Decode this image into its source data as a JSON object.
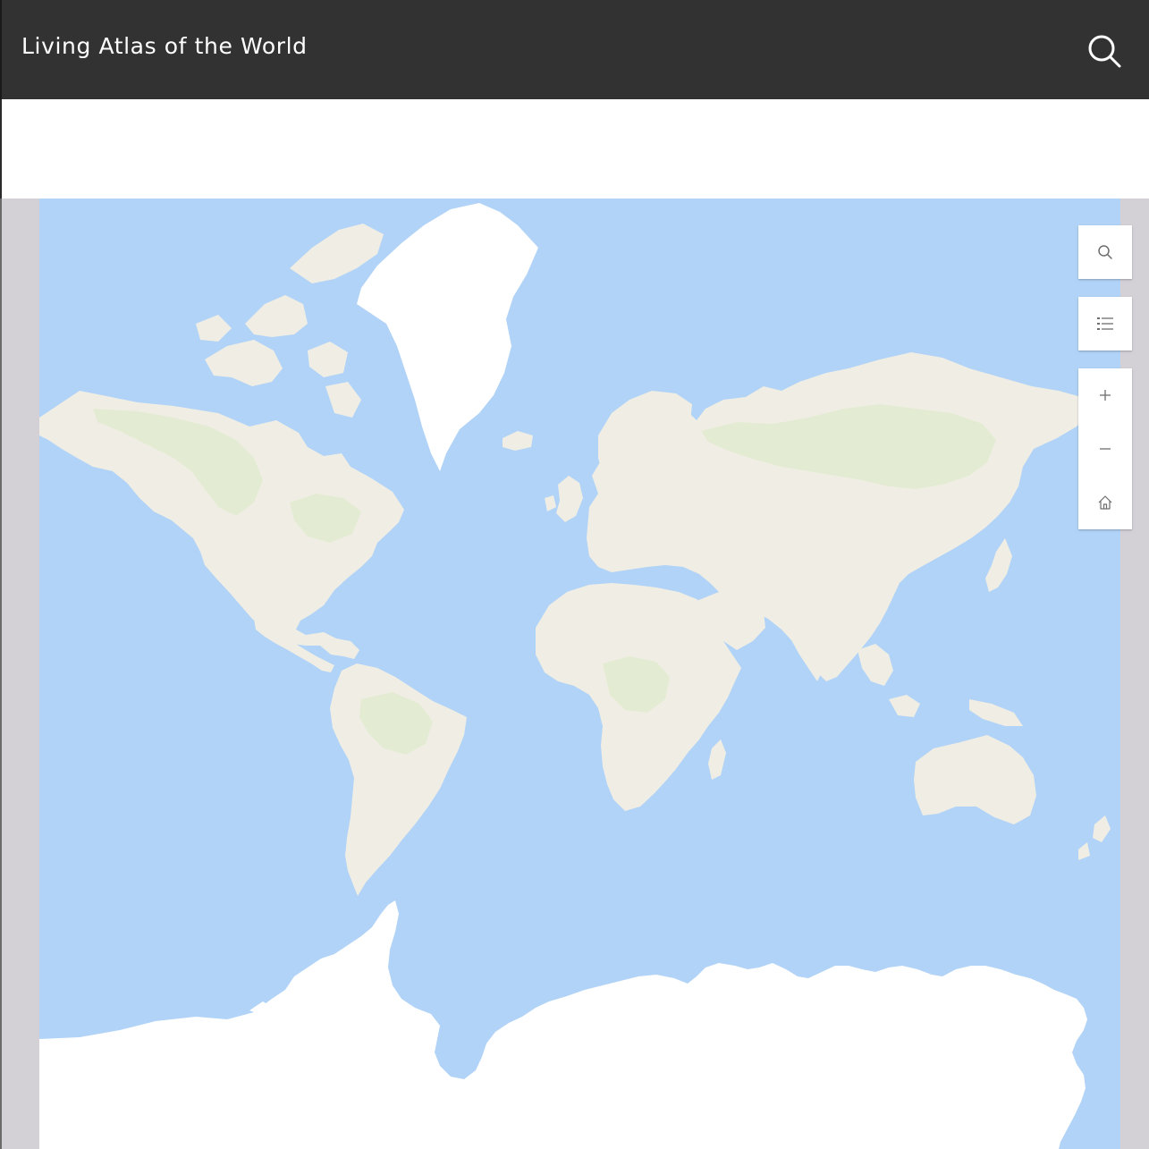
{
  "header": {
    "title": "Living Atlas of the World",
    "search_icon": "search-icon",
    "background": "#323232",
    "text_color": "#ffffff"
  },
  "map": {
    "ocean_color": "#b1d3f7",
    "land_color": "#f0eee4",
    "vegetation_color": "#e4ebd3",
    "ice_color": "#ffffff",
    "frame_color": "#d3d1d6"
  },
  "map_widgets": {
    "search": {
      "icon": "search-icon"
    },
    "layer_list": {
      "icon": "layer-list-icon"
    },
    "zoom_in": {
      "icon": "plus-icon"
    },
    "zoom_out": {
      "icon": "minus-icon"
    },
    "home": {
      "icon": "home-icon"
    }
  }
}
